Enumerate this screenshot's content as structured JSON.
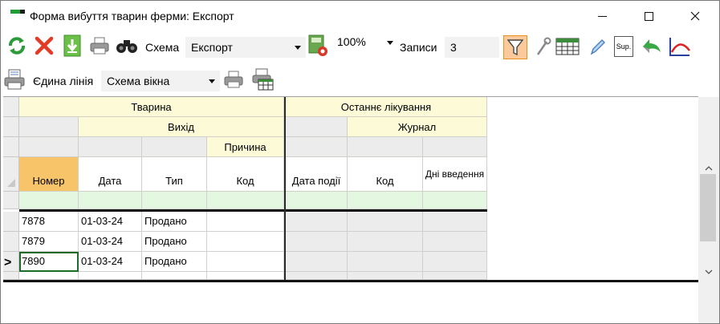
{
  "window": {
    "title": "Форма вибуття тварин ферми: Експорт"
  },
  "toolbar": {
    "scheme_label": "Схема",
    "scheme_value": "Експорт",
    "zoom_value": "100%",
    "records_label": "Записи",
    "records_value": "3",
    "single_line_label": "Єдина лінія",
    "window_scheme_value": "Схема вікна",
    "sup_label": "Sup."
  },
  "grid": {
    "group_animal": "Тварина",
    "group_last_treatment": "Останнє лікування",
    "sub_exit": "Вихід",
    "sub_journal": "Журнал",
    "sub_reason": "Причина",
    "columns": {
      "number": "Номер",
      "date": "Дата",
      "type": "Тип",
      "code": "Код",
      "event_date": "Дата події",
      "journal_code": "Код",
      "admin_days": "Дні введення"
    },
    "rows": [
      {
        "number": "7878",
        "date": "01-03-24",
        "type": "Продано"
      },
      {
        "number": "7879",
        "date": "01-03-24",
        "type": "Продано"
      },
      {
        "number": "7890",
        "date": "01-03-24",
        "type": "Продано"
      }
    ],
    "current_row_marker": ">"
  },
  "colors": {
    "header_yellow": "#fdfbd7",
    "header_grey": "#ececec",
    "sorted_column": "#f7c46a",
    "filter_row": "#e3f7e1",
    "active_filter_button": "#fbc99a"
  },
  "icons": [
    "refresh-icon",
    "delete-icon",
    "import-icon",
    "print-icon",
    "binoculars-icon",
    "scheme-save-icon",
    "filter-icon",
    "wrench-icon",
    "calendar-grid-icon",
    "pen-icon",
    "sup-icon",
    "recycle-icon",
    "chart-curve-icon",
    "single-line-print-icon",
    "print-grid-icon"
  ]
}
